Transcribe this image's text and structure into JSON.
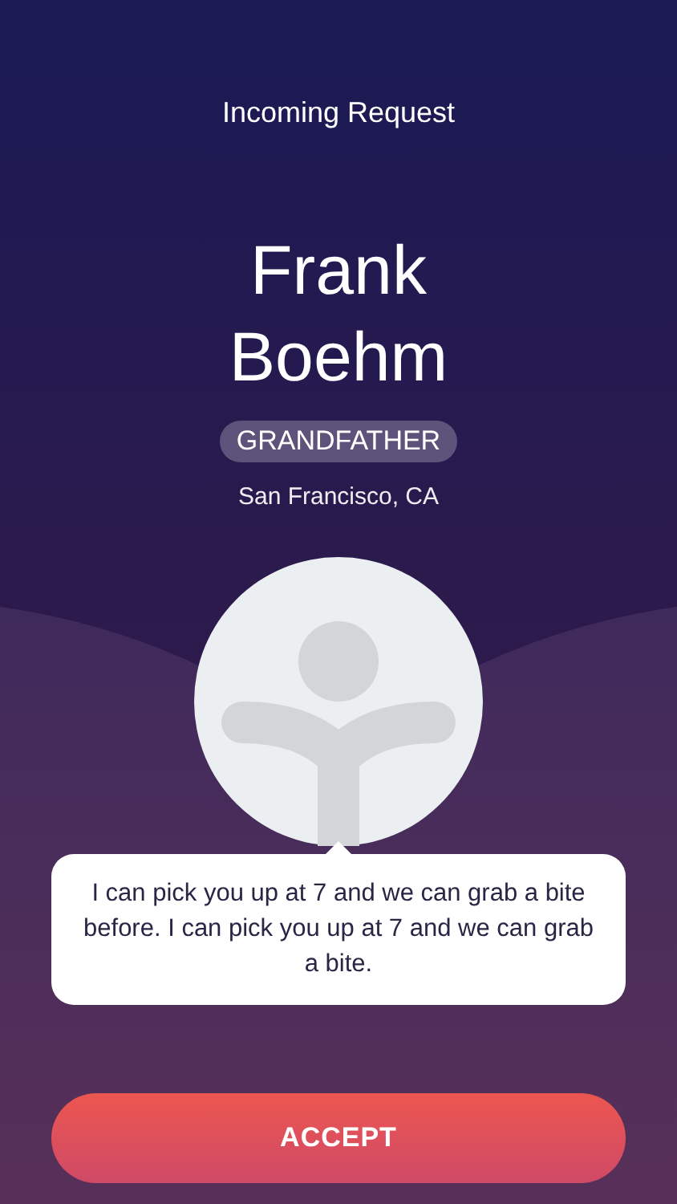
{
  "header": {
    "title": "Incoming Request"
  },
  "contact": {
    "name": "Frank Boehm",
    "relation": "GRANDFATHER",
    "location": "San Francisco, CA"
  },
  "message": {
    "text": "I can pick you up at 7 and we can grab a bite before. I can pick you up at 7 and we can grab a bite."
  },
  "buttons": [
    {
      "label": "ACCEPT",
      "kind": "primary"
    }
  ]
}
